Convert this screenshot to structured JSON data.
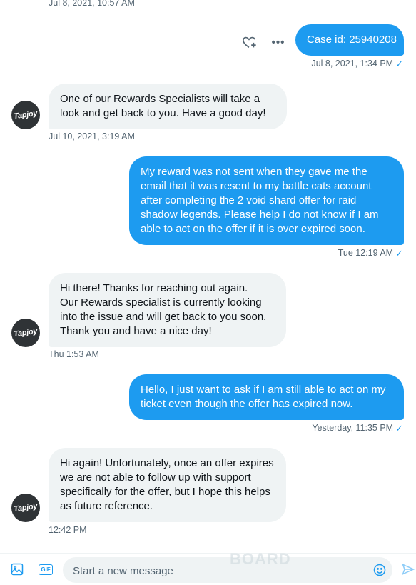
{
  "conversation": {
    "top_timestamp": "Jul 8, 2021, 10:57 AM",
    "case_bubble": {
      "text": "Case id: 25940208",
      "timestamp": "Jul 8, 2021, 1:34 PM"
    },
    "messages": [
      {
        "direction": "in",
        "lines": [
          "One of our Rewards Specialists will take a",
          "look and get back to you. Have a good day!"
        ],
        "timestamp": "Jul 10, 2021, 3:19 AM"
      },
      {
        "direction": "out",
        "lines": [
          "My reward was not sent when they gave me the",
          "email that it was resent to my battle cats account",
          "after completing the 2 void shard offer for raid",
          "shadow legends. Please help I do not know if I am",
          "able to act on the offer if it is over expired soon."
        ],
        "timestamp": "Tue 12:19 AM"
      },
      {
        "direction": "in",
        "lines": [
          "Hi there! Thanks for reaching out again.",
          "Our Rewards specialist is currently looking",
          "into the issue and will get back to you soon.",
          "Thank you and have a nice day!"
        ],
        "timestamp": "Thu 1:53 AM"
      },
      {
        "direction": "out",
        "lines": [
          "Hello, I just want to ask if I am still able to act on my",
          "ticket even though the offer has expired now."
        ],
        "timestamp": "Yesterday, 11:35 PM"
      },
      {
        "direction": "in",
        "lines": [
          "Hi again! Unfortunately, once an offer expires",
          "we are not able to follow up with support",
          "specifically for the offer, but I hope this helps",
          "as future reference."
        ],
        "timestamp": "12:42 PM"
      }
    ]
  },
  "avatar": {
    "label": "Tapjoy"
  },
  "actions": {
    "react_icon": "heart-plus-icon",
    "more_icon": "more-horizontal-icon",
    "more_label": "•••"
  },
  "read_receipt": "✓",
  "composer": {
    "placeholder": "Start a new message",
    "media_icon": "image-icon",
    "gif_label": "GIF",
    "emoji_icon": "emoji-icon",
    "send_icon": "send-icon"
  },
  "watermark": "BOARD",
  "colors": {
    "accent": "#1d9bf0",
    "incoming_bubble": "#eff3f4",
    "meta_text": "#536471"
  }
}
